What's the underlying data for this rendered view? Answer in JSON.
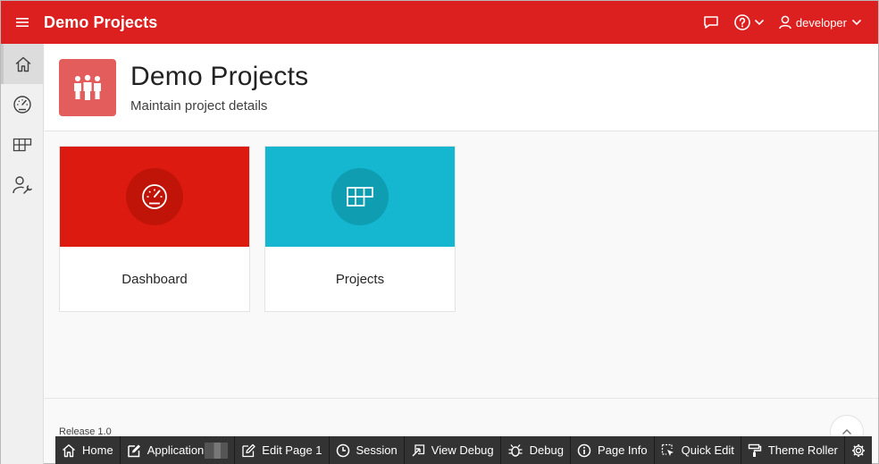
{
  "header": {
    "app_title": "Demo Projects",
    "user_name": "developer",
    "brand_color": "#dc1f1f"
  },
  "sidebar": {
    "items": [
      {
        "icon": "home-icon",
        "active": true
      },
      {
        "icon": "dashboard-gauge-icon",
        "active": false
      },
      {
        "icon": "grid-table-icon",
        "active": false
      },
      {
        "icon": "user-wrench-icon",
        "active": false
      }
    ]
  },
  "hero": {
    "title": "Demo Projects",
    "subtitle": "Maintain project details",
    "icon": "people-icon",
    "icon_color": "#e35d5d"
  },
  "cards": [
    {
      "label": "Dashboard",
      "icon": "dashboard-gauge-icon",
      "color": "#dd1a0f"
    },
    {
      "label": "Projects",
      "icon": "grid-table-icon",
      "color": "#15b6cf"
    }
  ],
  "footer": {
    "release": "Release 1.0"
  },
  "devbar": {
    "home": "Home",
    "application": "Application",
    "edit_page": "Edit Page 1",
    "session": "Session",
    "view_debug": "View Debug",
    "debug": "Debug",
    "page_info": "Page Info",
    "quick_edit": "Quick Edit",
    "theme_roller": "Theme Roller"
  }
}
